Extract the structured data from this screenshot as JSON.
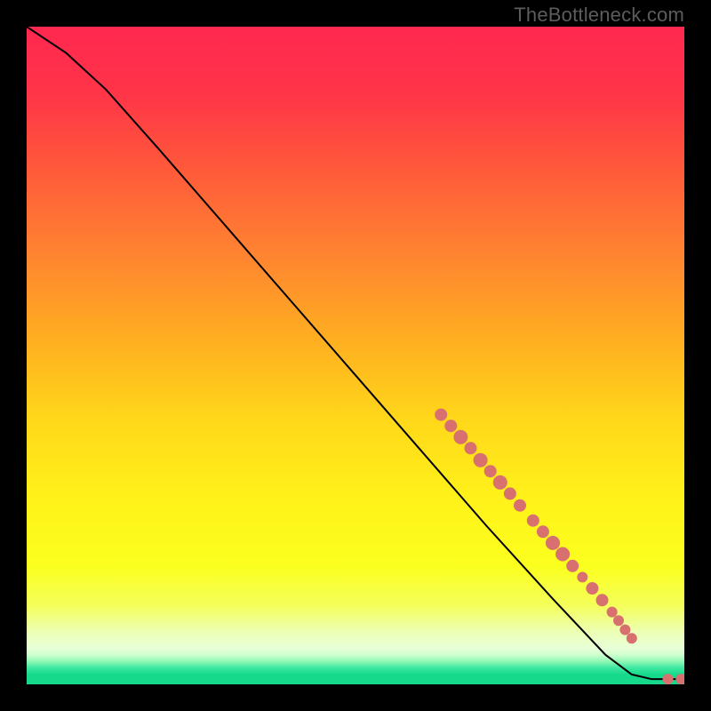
{
  "watermark": "TheBottleneck.com",
  "chart_data": {
    "type": "line",
    "title": "",
    "xlabel": "",
    "ylabel": "",
    "xlim": [
      0,
      100
    ],
    "ylim": [
      0,
      100
    ],
    "grid": false,
    "legend": false,
    "curve": [
      {
        "x": 0,
        "y": 100
      },
      {
        "x": 6,
        "y": 96
      },
      {
        "x": 12,
        "y": 90.5
      },
      {
        "x": 20,
        "y": 81.5
      },
      {
        "x": 30,
        "y": 70
      },
      {
        "x": 40,
        "y": 58.5
      },
      {
        "x": 50,
        "y": 47
      },
      {
        "x": 60,
        "y": 35.5
      },
      {
        "x": 70,
        "y": 24
      },
      {
        "x": 80,
        "y": 13
      },
      {
        "x": 88,
        "y": 4.5
      },
      {
        "x": 92,
        "y": 1.5
      },
      {
        "x": 95,
        "y": 0.8
      },
      {
        "x": 100,
        "y": 0.8
      }
    ],
    "points": [
      {
        "x": 63,
        "y": 41,
        "r": 7
      },
      {
        "x": 64.5,
        "y": 39.3,
        "r": 7
      },
      {
        "x": 66,
        "y": 37.6,
        "r": 8
      },
      {
        "x": 67.5,
        "y": 35.9,
        "r": 7
      },
      {
        "x": 69,
        "y": 34.1,
        "r": 8
      },
      {
        "x": 70.5,
        "y": 32.4,
        "r": 7
      },
      {
        "x": 72,
        "y": 30.7,
        "r": 8
      },
      {
        "x": 73.5,
        "y": 29,
        "r": 7
      },
      {
        "x": 75,
        "y": 27.2,
        "r": 7
      },
      {
        "x": 77,
        "y": 24.9,
        "r": 7
      },
      {
        "x": 78.5,
        "y": 23.2,
        "r": 7
      },
      {
        "x": 80,
        "y": 21.5,
        "r": 8
      },
      {
        "x": 81.5,
        "y": 19.8,
        "r": 8
      },
      {
        "x": 83,
        "y": 18,
        "r": 7
      },
      {
        "x": 84.5,
        "y": 16.3,
        "r": 6
      },
      {
        "x": 86,
        "y": 14.6,
        "r": 7
      },
      {
        "x": 87.5,
        "y": 12.8,
        "r": 7
      },
      {
        "x": 89,
        "y": 11,
        "r": 6
      },
      {
        "x": 90,
        "y": 9.7,
        "r": 6
      },
      {
        "x": 91,
        "y": 8.3,
        "r": 6
      },
      {
        "x": 92,
        "y": 7,
        "r": 6
      },
      {
        "x": 97.5,
        "y": 0.8,
        "r": 6
      },
      {
        "x": 99.5,
        "y": 0.8,
        "r": 6
      }
    ],
    "gradient_stops": [
      {
        "offset": 0.0,
        "color": "#ff2850"
      },
      {
        "offset": 0.1,
        "color": "#ff3448"
      },
      {
        "offset": 0.22,
        "color": "#ff5a3a"
      },
      {
        "offset": 0.35,
        "color": "#ff8530"
      },
      {
        "offset": 0.48,
        "color": "#ffb020"
      },
      {
        "offset": 0.6,
        "color": "#ffd81a"
      },
      {
        "offset": 0.72,
        "color": "#fff21a"
      },
      {
        "offset": 0.82,
        "color": "#fbff1e"
      },
      {
        "offset": 0.88,
        "color": "#f4ff5a"
      },
      {
        "offset": 0.92,
        "color": "#ecffb4"
      },
      {
        "offset": 0.945,
        "color": "#e8ffd8"
      },
      {
        "offset": 0.955,
        "color": "#d0ffd0"
      },
      {
        "offset": 0.965,
        "color": "#90f8b4"
      },
      {
        "offset": 0.975,
        "color": "#3ee8a0"
      },
      {
        "offset": 0.985,
        "color": "#16d98c"
      },
      {
        "offset": 1.0,
        "color": "#16d98c"
      }
    ],
    "point_color": "#d87070",
    "line_color": "#000000"
  }
}
